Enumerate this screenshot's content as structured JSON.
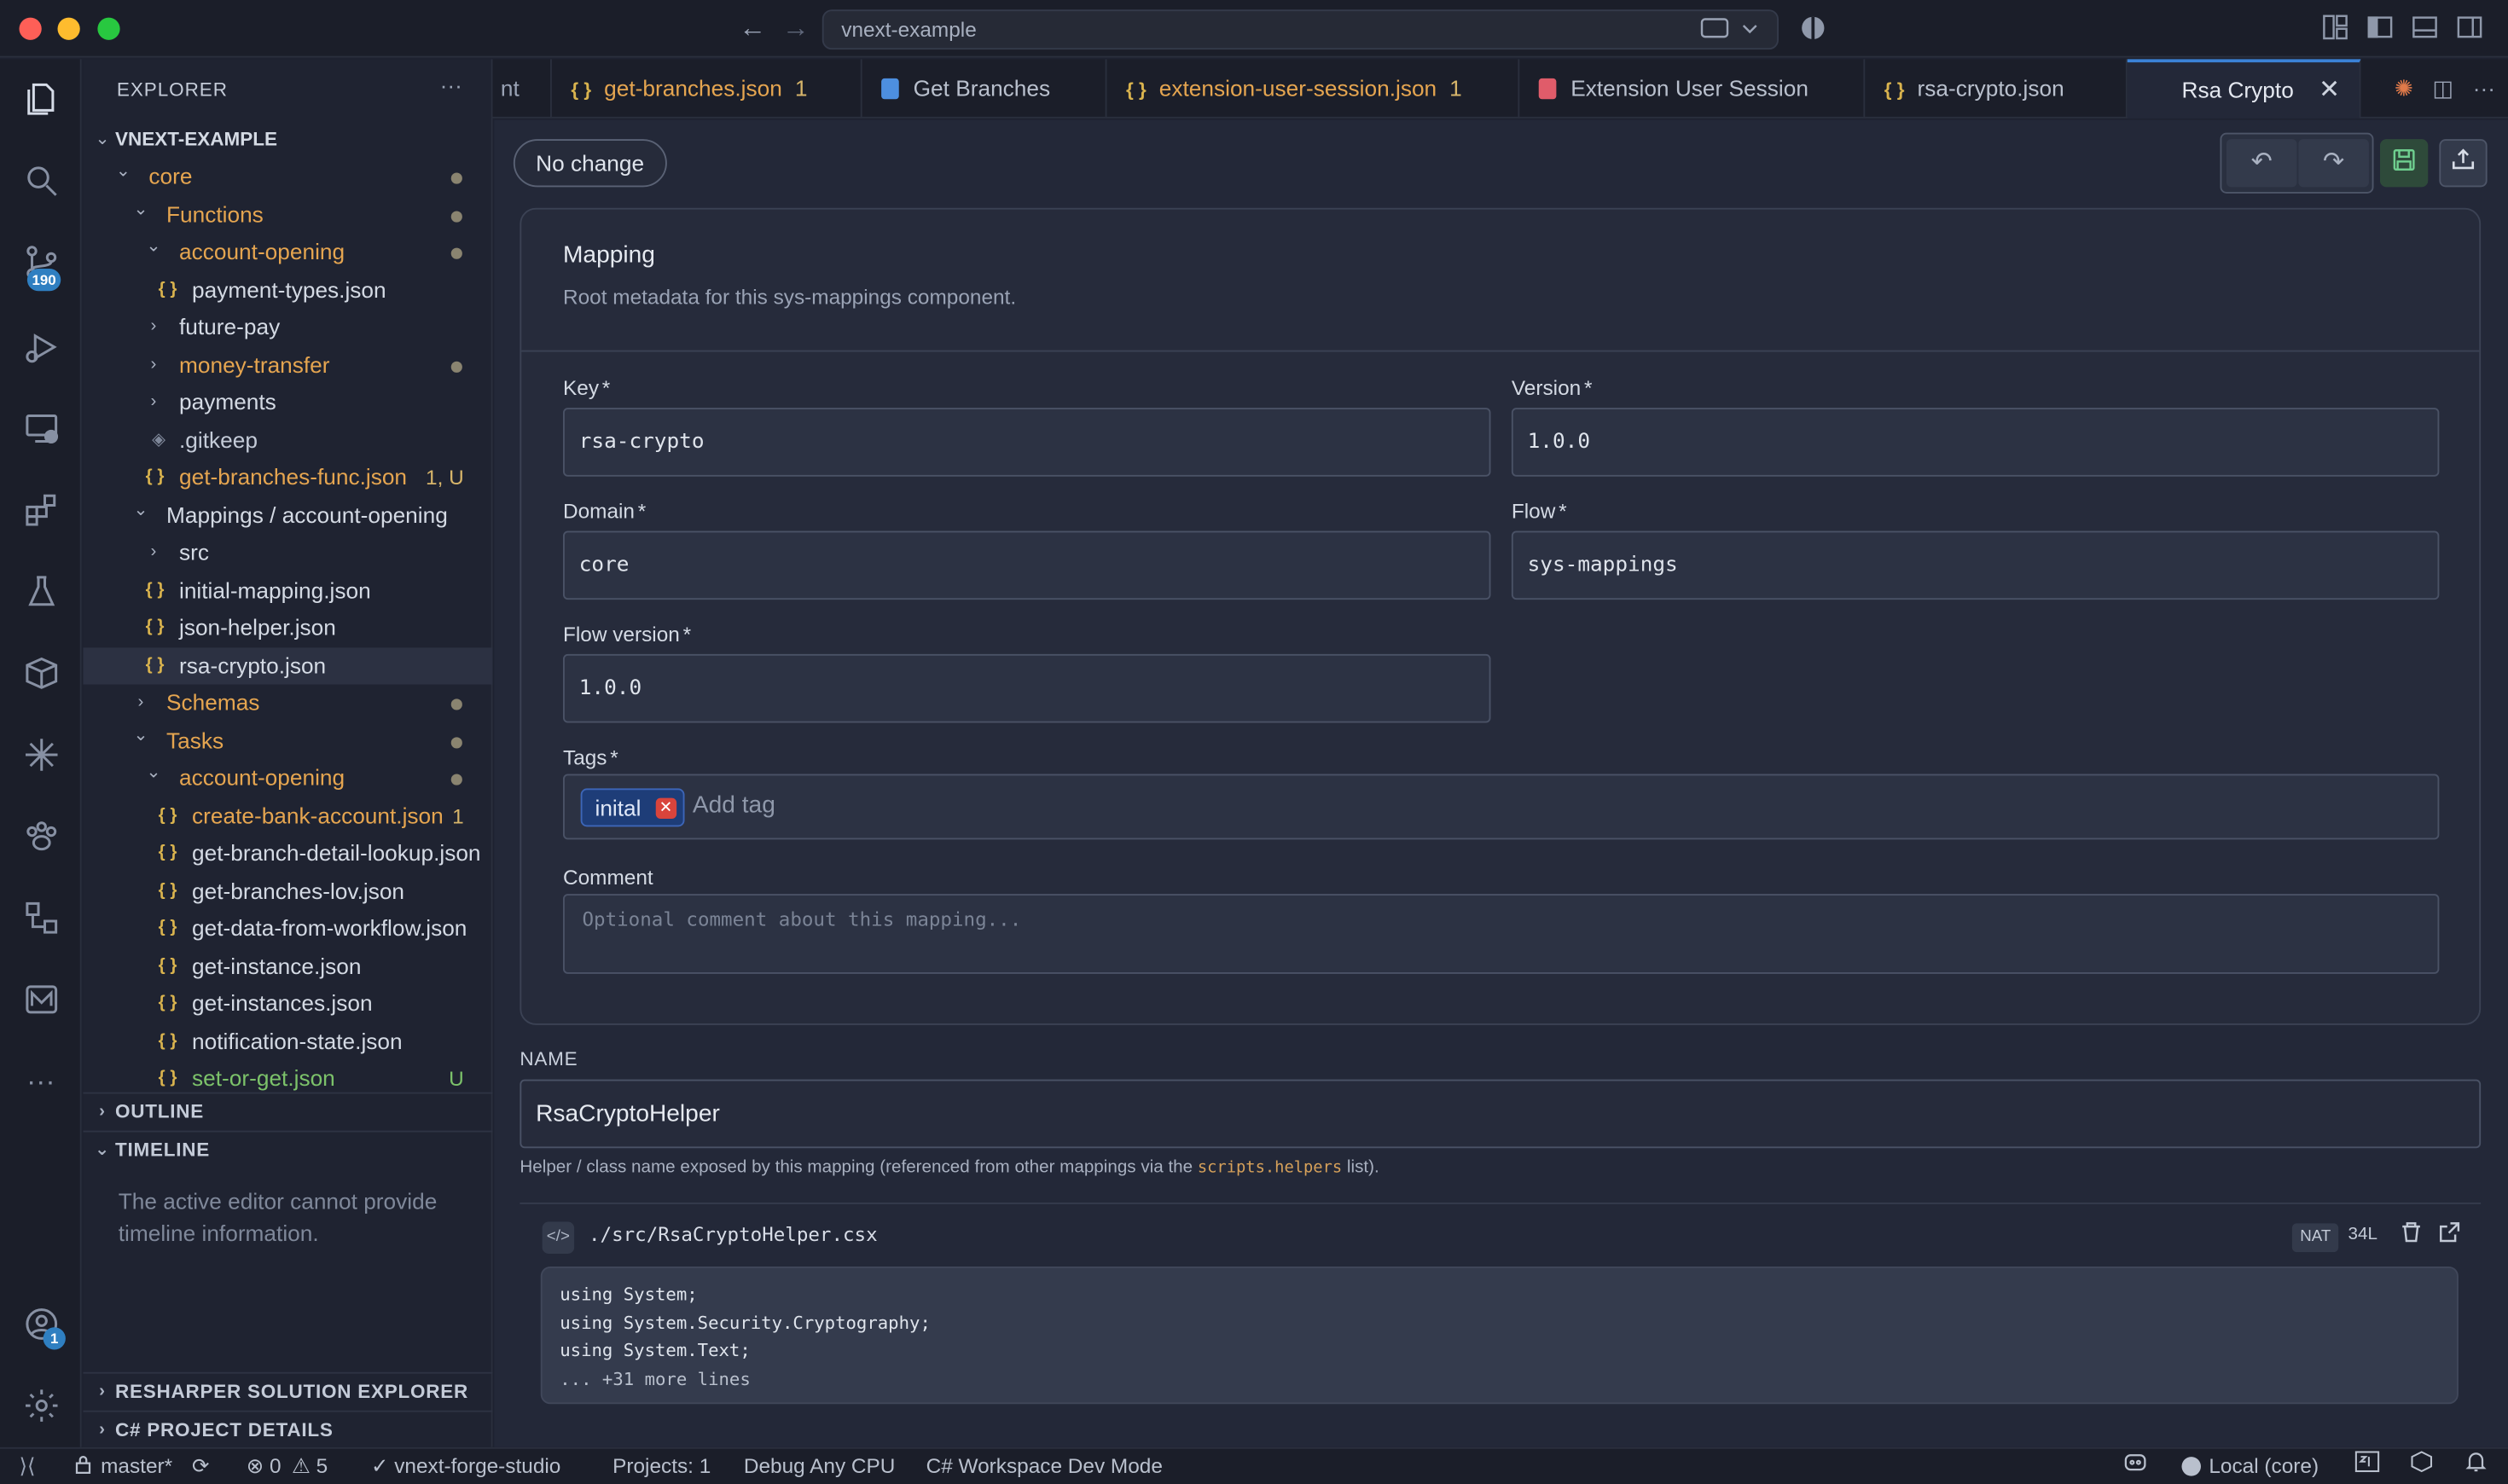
{
  "window": {
    "search_text": "vnext-example"
  },
  "activity_bar": {
    "scm_badge": "190",
    "accounts_badge": "1",
    "icons": [
      "files-icon",
      "search-icon",
      "source-control-icon",
      "run-debug-icon",
      "remote-explorer-icon",
      "extensions-icon",
      "testing-icon",
      "package-icon",
      "spark-icon",
      "pets-icon",
      "diagram-icon",
      "mail-icon",
      "more-icon",
      "accounts-icon",
      "gear-icon"
    ]
  },
  "explorer": {
    "title": "EXPLORER",
    "root": "VNEXT-EXAMPLE",
    "items": [
      {
        "label": "core",
        "depth": 1,
        "kind": "folder-open",
        "color": "orange",
        "dot": true
      },
      {
        "label": "Functions",
        "depth": 2,
        "kind": "folder-open",
        "color": "orange",
        "dot": true
      },
      {
        "label": "account-opening",
        "depth": 3,
        "kind": "folder-open",
        "color": "orange",
        "dot": true
      },
      {
        "label": "payment-types.json",
        "depth": 4,
        "kind": "json",
        "color": "white"
      },
      {
        "label": "future-pay",
        "depth": 3,
        "kind": "folder",
        "color": "white"
      },
      {
        "label": "money-transfer",
        "depth": 3,
        "kind": "folder",
        "color": "orange",
        "dot": true
      },
      {
        "label": "payments",
        "depth": 3,
        "kind": "folder",
        "color": "white"
      },
      {
        "label": ".gitkeep",
        "depth": 3,
        "kind": "gitkeep",
        "color": "gitkeep"
      },
      {
        "label": "get-branches-func.json",
        "depth": 3,
        "kind": "json",
        "color": "orange",
        "suffix": "1, U"
      },
      {
        "label": "Mappings / account-opening",
        "depth": 2,
        "kind": "folder-open",
        "color": "white"
      },
      {
        "label": "src",
        "depth": 3,
        "kind": "folder",
        "color": "white"
      },
      {
        "label": "initial-mapping.json",
        "depth": 3,
        "kind": "json",
        "color": "white"
      },
      {
        "label": "json-helper.json",
        "depth": 3,
        "kind": "json",
        "color": "white"
      },
      {
        "label": "rsa-crypto.json",
        "depth": 3,
        "kind": "json",
        "color": "white",
        "selected": true
      },
      {
        "label": "Schemas",
        "depth": 2,
        "kind": "folder",
        "color": "orange",
        "dot": true
      },
      {
        "label": "Tasks",
        "depth": 2,
        "kind": "folder-open",
        "color": "orange",
        "dot": true
      },
      {
        "label": "account-opening",
        "depth": 3,
        "kind": "folder-open",
        "color": "orange",
        "dot": true
      },
      {
        "label": "create-bank-account.json",
        "depth": 4,
        "kind": "json",
        "color": "orange",
        "suffix": "1"
      },
      {
        "label": "get-branch-detail-lookup.json",
        "depth": 4,
        "kind": "json",
        "color": "white"
      },
      {
        "label": "get-branches-lov.json",
        "depth": 4,
        "kind": "json",
        "color": "white"
      },
      {
        "label": "get-data-from-workflow.json",
        "depth": 4,
        "kind": "json",
        "color": "white"
      },
      {
        "label": "get-instance.json",
        "depth": 4,
        "kind": "json",
        "color": "white"
      },
      {
        "label": "get-instances.json",
        "depth": 4,
        "kind": "json",
        "color": "white"
      },
      {
        "label": "notification-state.json",
        "depth": 4,
        "kind": "json",
        "color": "white"
      },
      {
        "label": "set-or-get.json",
        "depth": 4,
        "kind": "json",
        "color": "green",
        "suffix": "U"
      }
    ],
    "sections": {
      "outline": "OUTLINE",
      "timeline": "TIMELINE",
      "timeline_msg": "The active editor cannot provide timeline information.",
      "resharper": "RESHARPER SOLUTION EXPLORER",
      "csharp": "C# PROJECT DETAILS"
    }
  },
  "tabs": [
    {
      "label": "nt",
      "icon": "",
      "color": "#9aa3b5"
    },
    {
      "label": "get-branches.json",
      "icon": "{ }",
      "color": "#e5a550",
      "mod": "1"
    },
    {
      "label": "Get Branches",
      "icon": "file-blue",
      "color": "#b9c0cd"
    },
    {
      "label": "extension-user-session.json",
      "icon": "{ }",
      "color": "#e5a550",
      "mod": "1"
    },
    {
      "label": "Extension User Session",
      "icon": "file-red",
      "color": "#b9c0cd"
    },
    {
      "label": "rsa-crypto.json",
      "icon": "{ }",
      "color": "#b9c0cd"
    },
    {
      "label": "Rsa Crypto",
      "icon": "",
      "color": "#e4e8f0",
      "active": true
    }
  ],
  "editor": {
    "status_pill": "No change",
    "card": {
      "title": "Mapping",
      "subtitle": "Root metadata for this sys-mappings component.",
      "key_label": "Key",
      "key_value": "rsa-crypto",
      "version_label": "Version",
      "version_value": "1.0.0",
      "domain_label": "Domain",
      "domain_value": "core",
      "flow_label": "Flow",
      "flow_value": "sys-mappings",
      "flow_version_label": "Flow version",
      "flow_version_value": "1.0.0",
      "tags_label": "Tags",
      "tag_chip": "inital",
      "tag_placeholder": "Add tag",
      "comment_label": "Comment",
      "comment_placeholder": "Optional comment about this mapping...",
      "required_mark": "*"
    },
    "name_label": "NAME",
    "name_value": "RsaCryptoHelper",
    "help_prefix": "Helper / class name exposed by this mapping (referenced from other mappings via the ",
    "help_code": "scripts.helpers",
    "help_suffix": " list).",
    "code_file": {
      "path": "./src/RsaCryptoHelper.csx",
      "badge": "NAT",
      "lines": "34L",
      "code_lines": [
        "using System;",
        "using System.Security.Cryptography;",
        "using System.Text;"
      ],
      "more": "... +31 more lines"
    }
  },
  "statusbar": {
    "branch": "master*",
    "errors": "0",
    "warnings": "5",
    "project": "vnext-forge-studio",
    "projects": "Projects: 1",
    "debug": "Debug Any CPU",
    "mode": "C# Workspace Dev Mode",
    "local": "Local (core)"
  }
}
